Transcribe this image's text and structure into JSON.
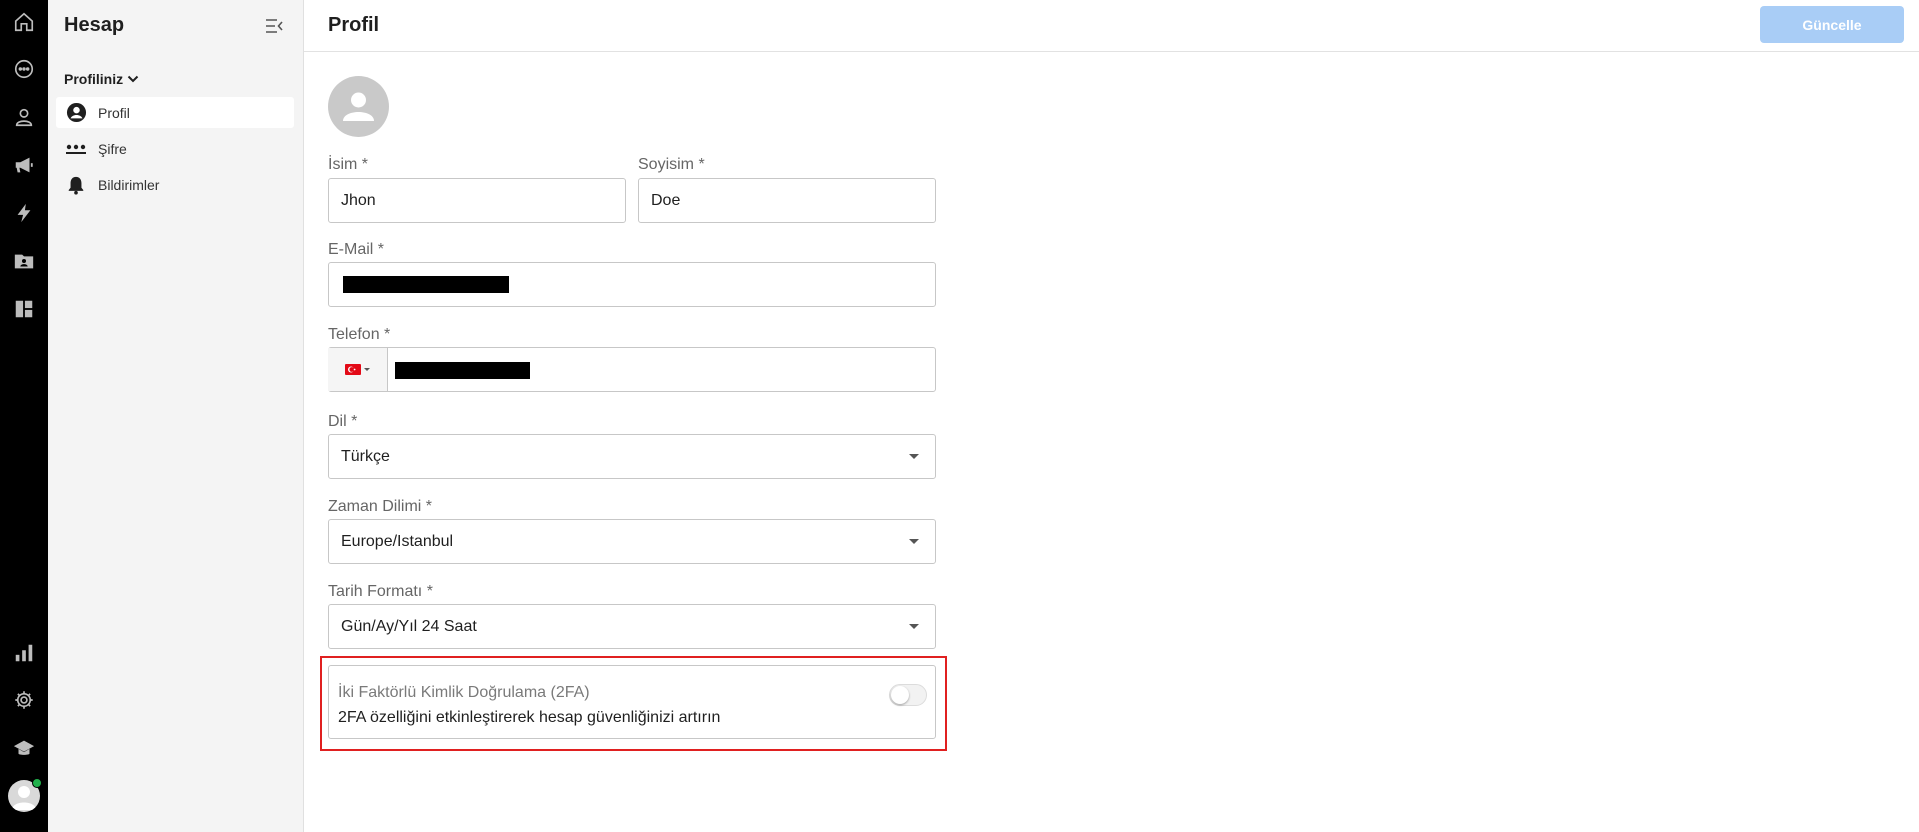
{
  "colors": {
    "rail_bg": "#000000",
    "sidebar_bg": "#f4f4f4",
    "primary_button_disabled": "#a9cdf6",
    "highlight_border": "#e02020",
    "online_status": "#22b14c"
  },
  "rail": {
    "top_icons": [
      "home-icon",
      "chat-icon",
      "contacts-icon",
      "megaphone-icon",
      "lightning-icon",
      "folder-user-icon",
      "dashboard-icon"
    ],
    "bottom_icons": [
      "bar-chart-icon",
      "gear-icon",
      "graduation-cap-icon",
      "avatar-icon"
    ]
  },
  "sidebar": {
    "title": "Hesap",
    "section_label": "Profiliniz",
    "items": [
      {
        "label": "Profil",
        "icon": "user-circle-icon",
        "active": true
      },
      {
        "label": "Şifre",
        "icon": "password-dots-icon",
        "active": false
      },
      {
        "label": "Bildirimler",
        "icon": "bell-icon",
        "active": false
      }
    ]
  },
  "header": {
    "title": "Profil",
    "update_button": "Güncelle"
  },
  "form": {
    "first_name": {
      "label": "İsim *",
      "value": "Jhon"
    },
    "last_name": {
      "label": "Soyisim *",
      "value": "Doe"
    },
    "email": {
      "label": "E-Mail *"
    },
    "phone": {
      "label": "Telefon *",
      "country_flag": "turkey-flag-icon"
    },
    "language": {
      "label": "Dil *",
      "value": "Türkçe"
    },
    "timezone": {
      "label": "Zaman Dilimi *",
      "value": "Europe/Istanbul"
    },
    "date_format": {
      "label": "Tarih Formatı *",
      "value": "Gün/Ay/Yıl 24 Saat"
    },
    "two_factor": {
      "title": "İki Faktörlü Kimlik Doğrulama (2FA)",
      "description": "2FA özelliğini etkinleştirerek hesap güvenliğinizi artırın",
      "enabled": false
    }
  }
}
